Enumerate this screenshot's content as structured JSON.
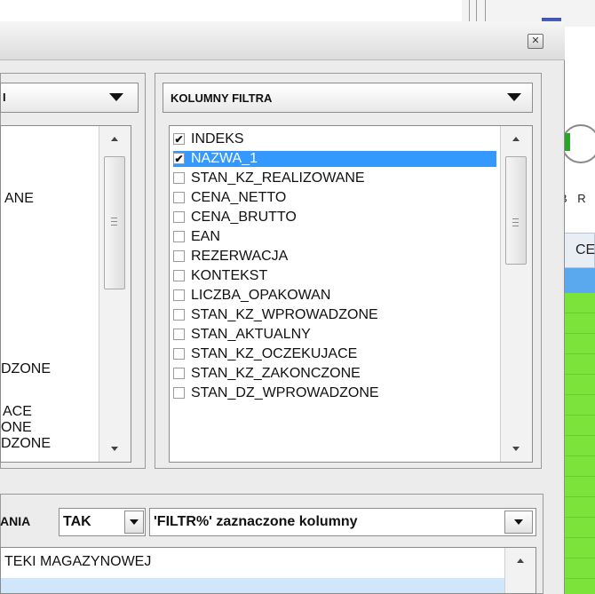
{
  "right_filter_panel": {
    "header_label": "KOLUMNY FILTRA",
    "items": [
      {
        "label": "INDEKS",
        "checked": true,
        "selected": false
      },
      {
        "label": "NAZWA_1",
        "checked": true,
        "selected": true
      },
      {
        "label": "STAN_KZ_REALIZOWANE",
        "checked": false,
        "selected": false
      },
      {
        "label": "CENA_NETTO",
        "checked": false,
        "selected": false
      },
      {
        "label": "CENA_BRUTTO",
        "checked": false,
        "selected": false
      },
      {
        "label": "EAN",
        "checked": false,
        "selected": false
      },
      {
        "label": "REZERWACJA",
        "checked": false,
        "selected": false
      },
      {
        "label": "KONTEKST",
        "checked": false,
        "selected": false
      },
      {
        "label": "LICZBA_OPAKOWAN",
        "checked": false,
        "selected": false
      },
      {
        "label": "STAN_KZ_WPROWADZONE",
        "checked": false,
        "selected": false
      },
      {
        "label": "STAN_AKTUALNY",
        "checked": false,
        "selected": false
      },
      {
        "label": "STAN_KZ_OCZEKUJACE",
        "checked": false,
        "selected": false
      },
      {
        "label": "STAN_KZ_ZAKONCZONE",
        "checked": false,
        "selected": false
      },
      {
        "label": "STAN_DZ_WPROWADZONE",
        "checked": false,
        "selected": false
      }
    ],
    "check_glyph": "✔"
  },
  "left_panel": {
    "header_label": "I",
    "visible_fragments": [
      "ANE",
      "DZONE",
      "ACE",
      "ONE",
      "DZONE"
    ]
  },
  "bottom_bar": {
    "label_fragment": "ANIA",
    "toggle_value": "TAK",
    "mode_value": "'FILTR%' zaznaczone kolumny",
    "list_first_item": "TEKI MAGAZYNOWEJ"
  },
  "background_app": {
    "br_label": "B R",
    "column_label": "CE"
  },
  "icons": {
    "close": "close-icon",
    "dropdown": "chevron-down-icon"
  },
  "colors": {
    "selection": "#3399ff",
    "green_rows": "#7ce33b",
    "blue_header": "#5aa8ee"
  }
}
